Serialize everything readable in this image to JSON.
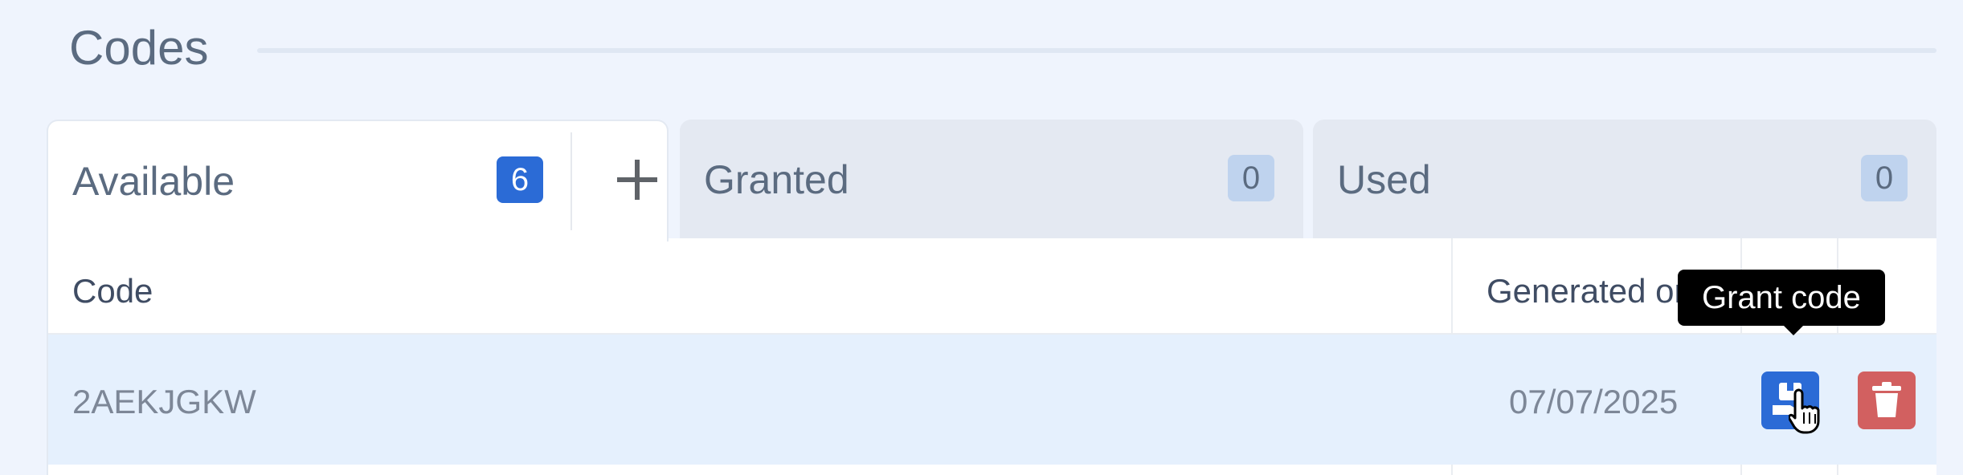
{
  "section": {
    "title": "Codes"
  },
  "tabs": [
    {
      "label": "Available",
      "count": "6",
      "active": true
    },
    {
      "label": "Granted",
      "count": "0",
      "active": false
    },
    {
      "label": "Used",
      "count": "0",
      "active": false
    }
  ],
  "add_button": {
    "icon": "plus-icon"
  },
  "table": {
    "headers": {
      "code": "Code",
      "generated_on": "Generated on"
    },
    "rows": [
      {
        "code": "2AEKJGKW",
        "generated_on": "07/07/2025"
      }
    ]
  },
  "actions": {
    "grant_icon": "grant-code-icon",
    "delete_icon": "trash-icon"
  },
  "tooltip": {
    "text": "Grant code"
  },
  "colors": {
    "primary": "#2b6bd6",
    "danger": "#d26060",
    "row_highlight": "#e5f0fd",
    "background": "#eff4fd"
  }
}
